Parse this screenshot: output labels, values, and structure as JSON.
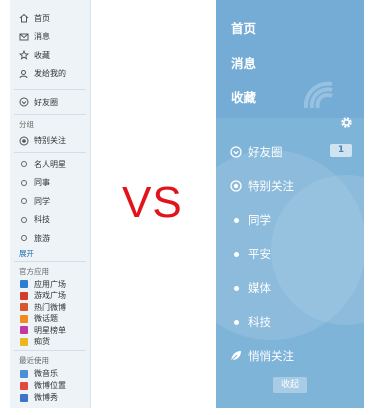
{
  "left": {
    "top_items": [
      {
        "icon": "home-icon",
        "label": "首页"
      },
      {
        "icon": "message-icon",
        "label": "消息"
      },
      {
        "icon": "star-icon",
        "label": "收藏"
      },
      {
        "icon": "user-sent-icon",
        "label": "发给我的"
      }
    ],
    "friends_label": "好友圈",
    "group_heading": "分组",
    "special_label": "特别关注",
    "groups": [
      "名人明星",
      "同事",
      "同学",
      "科技",
      "旅游"
    ],
    "groups_more": "展开",
    "apps_heading": "官方应用",
    "apps": [
      {
        "label": "应用广场",
        "color": "#2f7fd0"
      },
      {
        "label": "游戏广场",
        "color": "#d23b2e"
      },
      {
        "label": "热门微博",
        "color": "#d9572f"
      },
      {
        "label": "微话题",
        "color": "#f08b1c"
      },
      {
        "label": "明星榜单",
        "color": "#c13aa4"
      },
      {
        "label": "痴货",
        "color": "#e9b71e"
      }
    ],
    "recent_heading": "最近使用",
    "recent": [
      {
        "label": "微音乐",
        "color": "#4b8fd4"
      },
      {
        "label": "微博位置",
        "color": "#e04a3b"
      },
      {
        "label": "微博秀",
        "color": "#3e74c8"
      }
    ]
  },
  "vs_text": "VS",
  "right": {
    "top_items": [
      "首页",
      "消息",
      "收藏"
    ],
    "friends_label": "好友圈",
    "friends_badge": "1",
    "special_label": "特别关注",
    "groups": [
      "同学",
      "平安",
      "媒体",
      "科技"
    ],
    "quiet_label": "悄悄关注",
    "collapse_label": "收起"
  }
}
